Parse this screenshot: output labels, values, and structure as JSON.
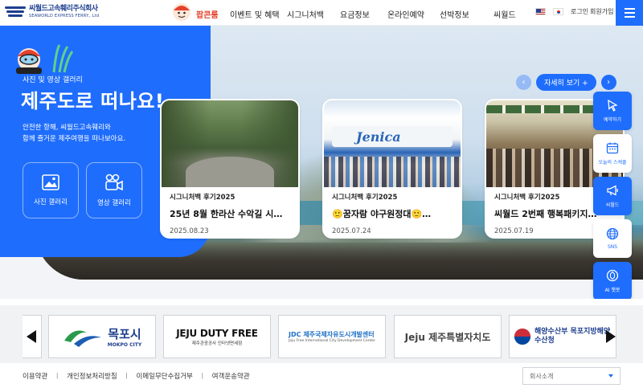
{
  "header": {
    "logo_ko": "씨월드고속훼리주식회사",
    "logo_en": "SEAWORLD EXPRESS FERRY., Ltd",
    "nav": [
      "팝콘룸",
      "이벤트 및 혜택",
      "시그니처백",
      "요금정보",
      "온라인예약",
      "선박정보",
      "씨월드"
    ],
    "login": "로그인",
    "signup": "회원가입"
  },
  "hero": {
    "subtitle": "사진 및 영상 갤러리",
    "title": "제주도로 떠나요!",
    "desc_line1": "안전한 항해, 씨월드고속훼리와",
    "desc_line2": "함께 즐거운 제주여행을 떠나보아요.",
    "photo_gallery": "사진 갤러리",
    "video_gallery": "영상 갤러리",
    "more": "자세히 보기 +",
    "prev_icon": "‹",
    "next_icon": "›"
  },
  "cards": [
    {
      "category": "시그니처백 후기2025",
      "title": "25년 8월 한라산 수악길 시그니…",
      "date": "2025.08.23"
    },
    {
      "category": "시그니처백 후기2025",
      "title": "🙂꿈자람 야구원정대🙂…",
      "date": "2025.07.24"
    },
    {
      "category": "시그니처백 후기2025",
      "title": "씨월드 2번째 행복패키지…",
      "date": "2025.07.19"
    }
  ],
  "quick_menu": [
    "예약하기",
    "오늘의 스케줄",
    "씨월드",
    "SNS",
    "AI 챗봇"
  ],
  "partners": [
    "목포시",
    "JEJU DUTY FREE",
    "JDC 제주국제자유도시개발센터",
    "Jeju 제주특별자치도",
    "해양수산부 목포지방해양수산청"
  ],
  "partner_sub": {
    "mokpo_en": "MOKPO CITY",
    "dutyfree_ko": "제주관광공사 인터넷면세점",
    "jdc_en": "Jeju Free International City Development Center"
  },
  "footer": {
    "links": [
      "이용약관",
      "개인정보처리방침",
      "이메일무단수집거부",
      "여객운송약관"
    ],
    "select": "회사소개"
  },
  "colors": {
    "brand": "#1f6dfc",
    "hot": "#e5432e",
    "navy": "#1d3f8f"
  }
}
